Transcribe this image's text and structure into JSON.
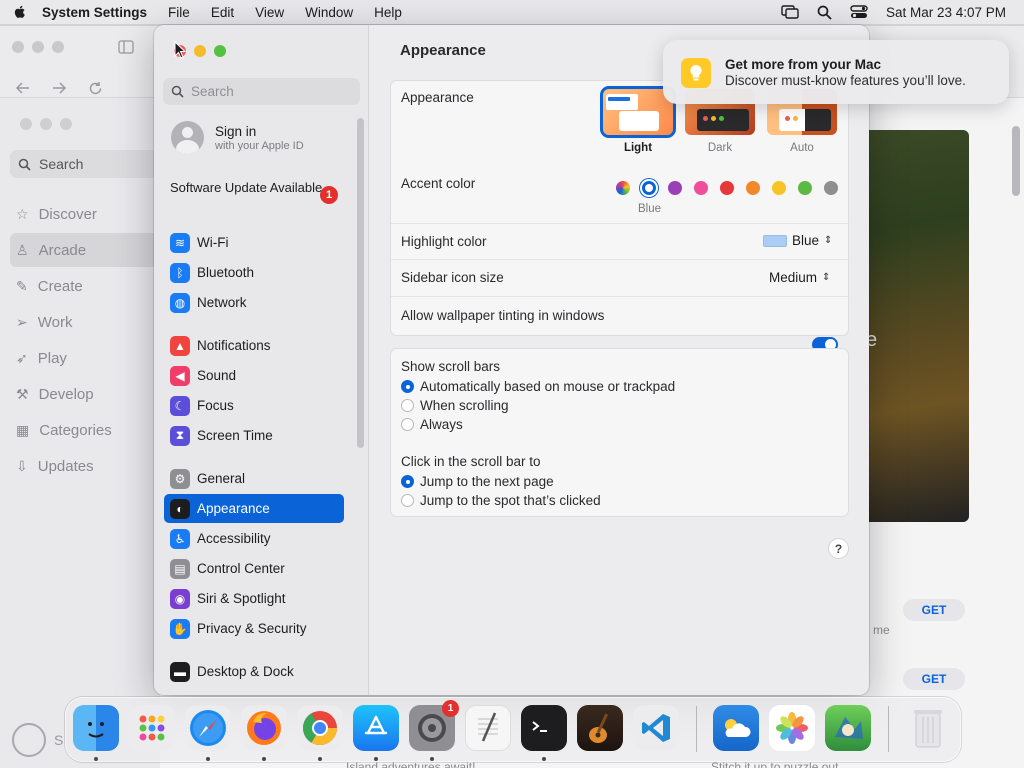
{
  "menubar": {
    "app_name": "System Settings",
    "menus": [
      "File",
      "Edit",
      "View",
      "Window",
      "Help"
    ],
    "datetime": "Sat Mar 23  4:07 PM"
  },
  "background_app": {
    "search_label": "Search",
    "items": [
      "Discover",
      "Arcade",
      "Create",
      "Work",
      "Play",
      "Develop",
      "Categories",
      "Updates"
    ],
    "selected": "Arcade",
    "get_label": "GET",
    "partial_text": [
      "me",
      "e"
    ],
    "user_initial": "S",
    "bottom_text_1": "Island adventures await!",
    "bottom_text_2": "Stitch it up to puzzle out"
  },
  "sidebar": {
    "search_placeholder": "Search",
    "sign_in": "Sign in",
    "sign_in_sub": "with your Apple ID",
    "software_update": "Software Update Available",
    "software_update_badge": "1",
    "groups": [
      [
        {
          "label": "Wi-Fi",
          "icon": "wifi-icon",
          "color": "#1a7cf5"
        },
        {
          "label": "Bluetooth",
          "icon": "bluetooth-icon",
          "color": "#1a7cf5"
        },
        {
          "label": "Network",
          "icon": "globe-icon",
          "color": "#1a7cf5"
        }
      ],
      [
        {
          "label": "Notifications",
          "icon": "bell-icon",
          "color": "#f0453e"
        },
        {
          "label": "Sound",
          "icon": "speaker-icon",
          "color": "#ef3e6a"
        },
        {
          "label": "Focus",
          "icon": "moon-icon",
          "color": "#5b4ed8"
        },
        {
          "label": "Screen Time",
          "icon": "hourglass-icon",
          "color": "#5b4ed8"
        }
      ],
      [
        {
          "label": "General",
          "icon": "gear-icon",
          "color": "#8e8e93"
        },
        {
          "label": "Appearance",
          "icon": "appearance-icon",
          "color": "#1d1d1f"
        },
        {
          "label": "Accessibility",
          "icon": "accessibility-icon",
          "color": "#1a7cf5"
        },
        {
          "label": "Control Center",
          "icon": "control-center-icon",
          "color": "#8e8e93"
        },
        {
          "label": "Siri & Spotlight",
          "icon": "siri-icon",
          "color": "#7a3fd1"
        },
        {
          "label": "Privacy & Security",
          "icon": "hand-icon",
          "color": "#1a7cf5"
        }
      ],
      [
        {
          "label": "Desktop & Dock",
          "icon": "dock-icon",
          "color": "#1d1d1f"
        }
      ]
    ],
    "selected": "Appearance"
  },
  "content": {
    "title": "Appearance",
    "appearance_label": "Appearance",
    "appearance_options": [
      {
        "label": "Light",
        "selected": true
      },
      {
        "label": "Dark",
        "selected": false
      },
      {
        "label": "Auto",
        "selected": false
      }
    ],
    "accent_label": "Accent color",
    "accent_colors": [
      "multicolor",
      "#0a64d8",
      "#9a3fb8",
      "#ef4f9a",
      "#e5383b",
      "#f1882a",
      "#f7c325",
      "#5cb944",
      "#8e8e93"
    ],
    "accent_selected_name": "Blue",
    "highlight_label": "Highlight color",
    "highlight_value": "Blue",
    "highlight_swatch": "#aacdf5",
    "sidebar_icon_label": "Sidebar icon size",
    "sidebar_icon_value": "Medium",
    "tinting_label": "Allow wallpaper tinting in windows",
    "tinting_on": true,
    "scrollbars_label": "Show scroll bars",
    "scrollbar_options": [
      {
        "label": "Automatically based on mouse or trackpad",
        "selected": true
      },
      {
        "label": "When scrolling",
        "selected": false
      },
      {
        "label": "Always",
        "selected": false
      }
    ],
    "click_label": "Click in the scroll bar to",
    "click_options": [
      {
        "label": "Jump to the next page",
        "selected": true
      },
      {
        "label": "Jump to the spot that’s clicked",
        "selected": false
      }
    ],
    "help": "?"
  },
  "notification": {
    "title": "Get more from your Mac",
    "body": "Discover must-know features you’ll love."
  },
  "dock": {
    "settings_badge": "1"
  }
}
